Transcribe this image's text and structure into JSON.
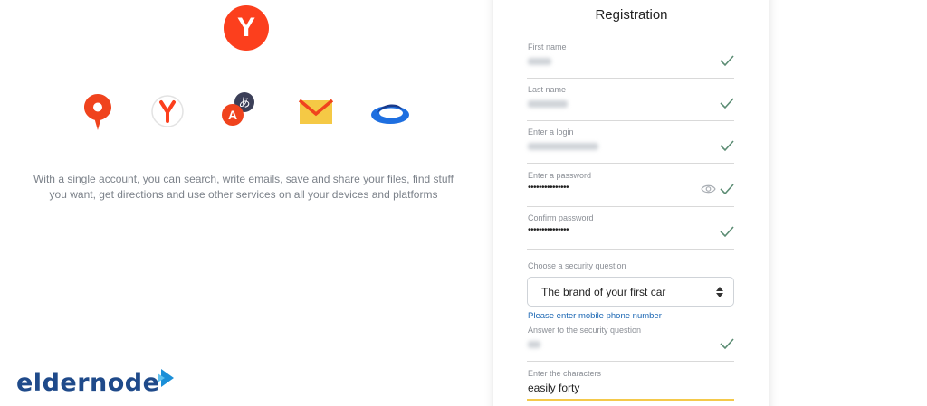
{
  "brand": {
    "yandex_letter": "Y",
    "watermark": "eldernode"
  },
  "services": [
    {
      "icon": "maps-pin-icon",
      "color": "#f0431d"
    },
    {
      "icon": "yandex-browser-icon",
      "color": "#fc3f1d"
    },
    {
      "icon": "translate-icon",
      "color": "#f0431d"
    },
    {
      "icon": "mail-icon",
      "color": "#f5c945"
    },
    {
      "icon": "disk-icon",
      "color": "#1e6fe0"
    }
  ],
  "promo_text": "With a single account, you can search, write emails, save and share your files, find stuff you want, get directions and use other services on all your devices and platforms",
  "form": {
    "title": "Registration",
    "first_name_label": "First name",
    "last_name_label": "Last name",
    "login_label": "Enter a login",
    "password_label": "Enter a password",
    "password_value": "•••••••••••••••",
    "confirm_label": "Confirm password",
    "confirm_value": "•••••••••••••••",
    "security_question_label": "Choose a security question",
    "security_question_value": "The brand of your first car",
    "phone_link": "Please enter mobile phone number",
    "answer_label": "Answer to the security question",
    "captcha_label": "Enter the characters",
    "captcha_value": "easily forty"
  },
  "colors": {
    "accent_red": "#fc3f1d",
    "check_green": "#5b8c73",
    "link_blue": "#1a66b3",
    "captcha_underline": "#f4c94a"
  }
}
